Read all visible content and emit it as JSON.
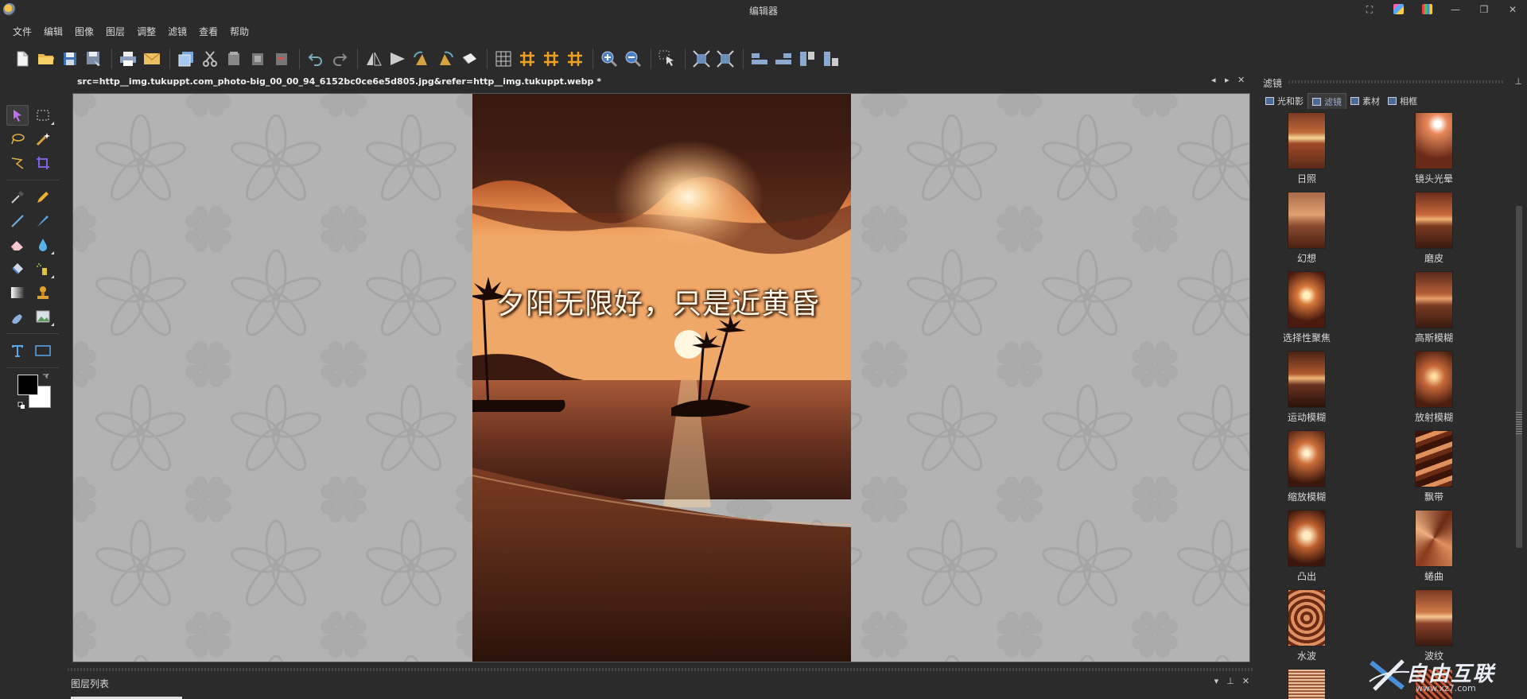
{
  "window": {
    "title": "编辑器",
    "controls": [
      "⛶",
      "",
      "",
      "—",
      "❐",
      "✕"
    ]
  },
  "menu": [
    "文件",
    "编辑",
    "图像",
    "图层",
    "调整",
    "滤镜",
    "查看",
    "帮助"
  ],
  "toolbar": {
    "icons": [
      "new-file-icon",
      "open-folder-icon",
      "save-icon",
      "save-as-icon",
      "print-icon",
      "email-icon",
      "duplicate-icon",
      "cut-icon",
      "copy-icon",
      "paste-icon",
      "clear-icon",
      "undo-icon",
      "redo-icon",
      "flip-horizontal-icon",
      "flip-vertical-icon",
      "rotate-left-icon",
      "rotate-right-icon",
      "rotate-free-icon",
      "grid-icon",
      "grid-hash-icon",
      "grid-hash-2-icon",
      "grid-hash-3-icon",
      "zoom-in-icon",
      "zoom-out-icon",
      "selection-pointer-icon",
      "fit-icon",
      "fit-actual-icon",
      "align-left-icon",
      "align-bottom-icon",
      "align-right-icon",
      "align-top-icon"
    ]
  },
  "document": {
    "tab_label": "src=http__img.tukuppt.com_photo-big_00_00_94_6152bc0ce6e5d805.jpg&refer=http__img.tukuppt.webp *",
    "nav_prev": "◂",
    "nav_next": "▸",
    "nav_close": "✕",
    "caption": "夕阳无限好，只是近黄昏"
  },
  "layers_panel": {
    "title": "图层列表",
    "controls": [
      "▾",
      "⊥",
      "✕"
    ]
  },
  "right_panel": {
    "title": "滤镜",
    "pin": "⊥",
    "tabs": [
      {
        "label": "光和影",
        "active": false
      },
      {
        "label": "滤镜",
        "active": true
      },
      {
        "label": "素材",
        "active": false
      },
      {
        "label": "相框",
        "active": false
      }
    ],
    "filters": [
      {
        "label": "日照",
        "style": "sun"
      },
      {
        "label": "镜头光晕",
        "style": "flare"
      },
      {
        "label": "幻想",
        "style": "fantasy"
      },
      {
        "label": "磨皮",
        "style": "smooth"
      },
      {
        "label": "选择性聚焦",
        "style": "focus"
      },
      {
        "label": "高斯模糊",
        "style": "gauss"
      },
      {
        "label": "运动模糊",
        "style": "motion"
      },
      {
        "label": "放射模糊",
        "style": "radial"
      },
      {
        "label": "缩放模糊",
        "style": "zoom"
      },
      {
        "label": "飘带",
        "style": "ribbon"
      },
      {
        "label": "凸出",
        "style": "bulge"
      },
      {
        "label": "蜷曲",
        "style": "swirl"
      },
      {
        "label": "水波",
        "style": "ripple"
      },
      {
        "label": "波纹",
        "style": "wave"
      },
      {
        "label": "",
        "style": "lines"
      },
      {
        "label": "",
        "style": "mesh"
      }
    ]
  },
  "tools": [
    "select-arrow-icon",
    "rect-select-icon",
    "lasso-icon",
    "magic-wand-icon",
    "polygon-lasso-icon",
    "crop-icon",
    "color-picker-icon",
    "pencil-icon",
    "line-icon",
    "brush-icon",
    "eraser-icon",
    "drop-icon",
    "fill-bucket-icon",
    "spray-icon",
    "gradient-icon",
    "stamp-icon",
    "smudge-icon",
    "image-icon",
    "text-icon",
    "rectangle-icon"
  ],
  "watermark": {
    "brand": "自由互联",
    "url": "www.xz7.com"
  }
}
